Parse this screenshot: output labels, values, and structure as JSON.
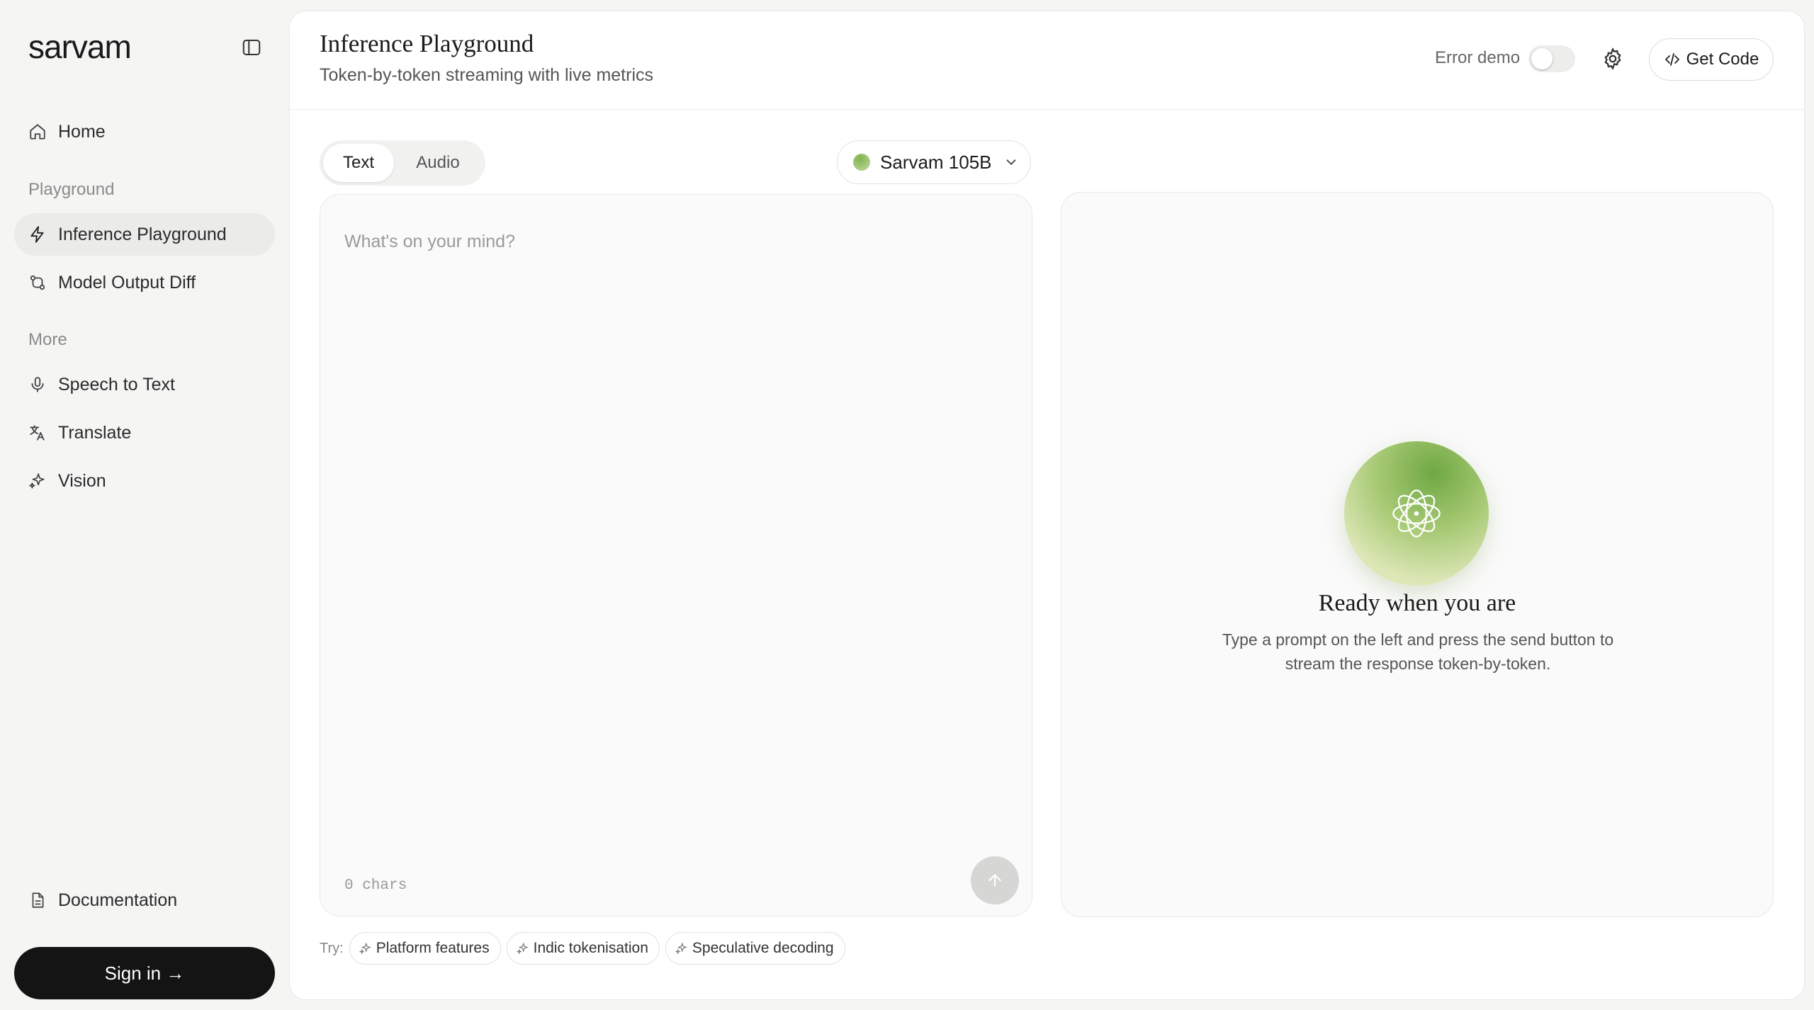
{
  "sidebar": {
    "logo": "sarvam",
    "home": "Home",
    "section_playground": "Playground",
    "inference_playground": "Inference Playground",
    "model_output_diff": "Model Output Diff",
    "section_more": "More",
    "speech_to_text": "Speech to Text",
    "translate": "Translate",
    "vision": "Vision",
    "documentation": "Documentation",
    "sign_in": "Sign in →"
  },
  "header": {
    "title": "Inference Playground",
    "subtitle": "Token-by-token streaming with live metrics",
    "error_demo_label": "Error demo",
    "error_demo_enabled": false,
    "get_code_label": "Get Code"
  },
  "tabs": [
    {
      "label": "Text",
      "active": true
    },
    {
      "label": "Audio",
      "active": false
    }
  ],
  "model": {
    "name": "Sarvam 105B"
  },
  "prompt": {
    "value": "",
    "placeholder": "What's on your mind?",
    "char_count": "0 chars"
  },
  "output": {
    "empty_title": "Ready when you are",
    "empty_description": "Type a prompt on the left and press the send button to stream the response token-by-token."
  },
  "suggestions": {
    "label": "Try:",
    "items": [
      "Platform features",
      "Indic tokenisation",
      "Speculative decoding"
    ]
  },
  "colors": {
    "accent_green": "#7fb24d",
    "signin_bg": "#141414"
  }
}
